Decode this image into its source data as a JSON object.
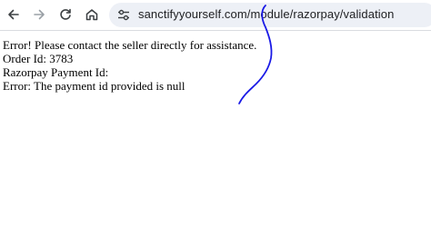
{
  "browser": {
    "back_icon": "arrow-left-icon",
    "forward_icon": "arrow-right-icon",
    "reload_icon": "reload-icon",
    "home_icon": "home-icon",
    "site_info_icon": "tune-icon",
    "url": "sanctifyyourself.com/module/razorpay/validation"
  },
  "page": {
    "lines": [
      "Error! Please contact the seller directly for assistance.",
      "Order Id: 3783",
      "Razorpay Payment Id:",
      "Error: The payment id provided is null"
    ]
  },
  "annotation": {
    "color": "#1a1ae6"
  }
}
